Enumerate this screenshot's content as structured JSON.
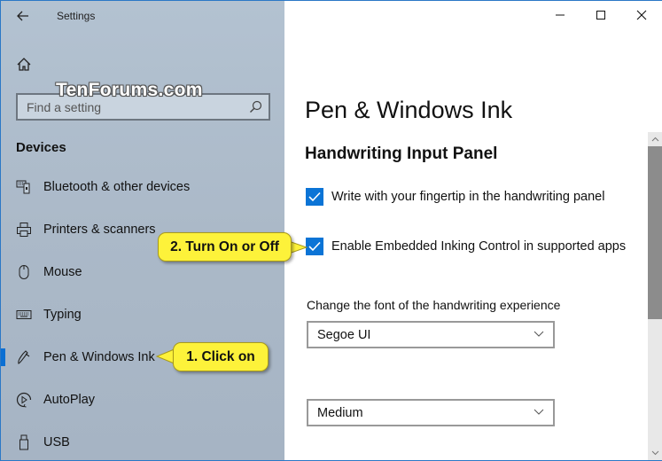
{
  "window": {
    "app_title": "Settings",
    "controls": {
      "minimize": "minimize-icon",
      "maximize": "maximize-icon",
      "close": "close-icon"
    }
  },
  "sidebar": {
    "back_icon": "back-arrow-icon",
    "home_icon": "home-icon",
    "watermark": "TenForums.com",
    "search": {
      "placeholder": "Find a setting",
      "value": "",
      "icon": "search-icon"
    },
    "section_heading": "Devices",
    "items": [
      {
        "label": "Bluetooth & other devices",
        "icon": "bluetooth-devices-icon",
        "selected": false
      },
      {
        "label": "Printers & scanners",
        "icon": "printer-icon",
        "selected": false
      },
      {
        "label": "Mouse",
        "icon": "mouse-icon",
        "selected": false
      },
      {
        "label": "Typing",
        "icon": "keyboard-icon",
        "selected": false
      },
      {
        "label": "Pen & Windows Ink",
        "icon": "pen-icon",
        "selected": true
      },
      {
        "label": "AutoPlay",
        "icon": "autoplay-icon",
        "selected": false
      },
      {
        "label": "USB",
        "icon": "usb-icon",
        "selected": false
      }
    ]
  },
  "main": {
    "page_title": "Pen & Windows Ink",
    "section_title": "Handwriting Input Panel",
    "checkboxes": [
      {
        "label": "Write with your fingertip in the handwriting panel",
        "checked": true
      },
      {
        "label": "Enable Embedded Inking Control in supported apps",
        "checked": true
      }
    ],
    "font_label": "Change the font of the handwriting experience",
    "font_dropdown": {
      "selected": "Segoe UI"
    },
    "size_dropdown": {
      "selected": "Medium"
    }
  },
  "annotations": {
    "callout_1": "1. Click on",
    "callout_2": "2. Turn On or Off"
  },
  "colors": {
    "accent": "#0b74d6",
    "sidebar_bg": "#abb9c8",
    "callout_bg": "#fdf23a"
  }
}
